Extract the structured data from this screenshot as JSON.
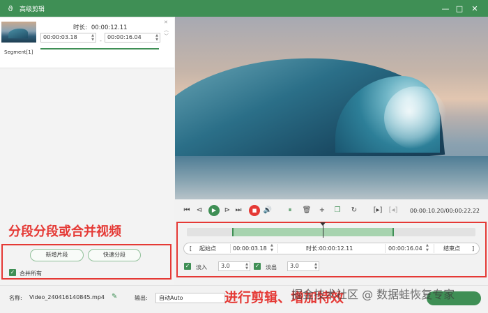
{
  "window": {
    "title": "高级剪辑",
    "logo_glyph": "ϑ"
  },
  "segment": {
    "label": "Segment[1]",
    "duration_label": "时长:",
    "duration": "00:00:12.11",
    "start": "00:00:03.18",
    "end": "00:00:16.04",
    "separator": "-"
  },
  "left_actions": {
    "annotation": "分段分段或合并视频",
    "new_segment": "新增片段",
    "quick_split": "快速分段",
    "merge_all": "合并所有"
  },
  "player": {
    "time_readout": "00:00:10.20/00:00:22.22"
  },
  "range": {
    "open_bracket": "[",
    "start_label": "起始点",
    "start": "00:00:03.18",
    "duration_label": "时长:",
    "duration": "00:00:12.11",
    "end": "00:00:16.04",
    "end_label": "结束点",
    "close_bracket": "]"
  },
  "fade": {
    "fade_in_label": "淡入",
    "fade_in_value": "3.0",
    "fade_out_label": "淡出",
    "fade_out_value": "3.0"
  },
  "right_annotation": "进行剪辑、增加特效",
  "bottom": {
    "name_label": "名称:",
    "file_name": "Video_240416140845.mp4",
    "output_label": "输出:",
    "output_value": "自动Auto"
  },
  "watermark": "掘金技术社区 @ 数据蛙恢复专家",
  "colors": {
    "brand": "#3f8f55",
    "annotation": "#e53935"
  }
}
